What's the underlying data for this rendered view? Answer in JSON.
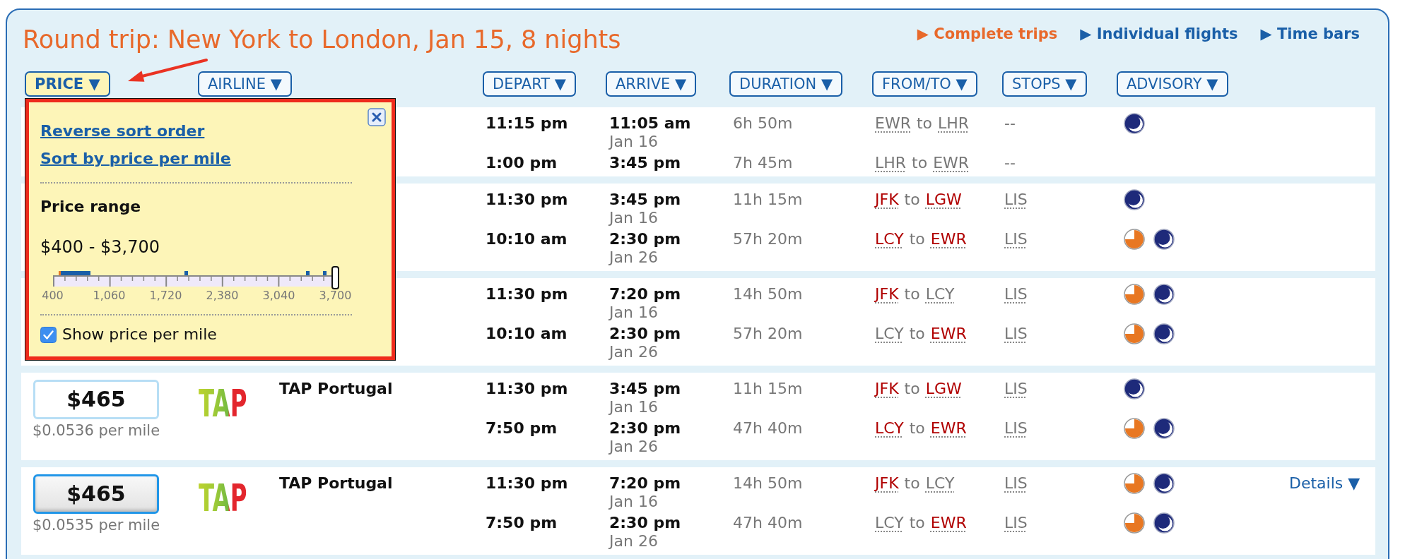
{
  "title": "Round trip: New York to London, Jan 15, 8 nights",
  "view_tabs": [
    {
      "label": "▶ Complete trips",
      "selected": true
    },
    {
      "label": "▶ Individual flights",
      "selected": false
    },
    {
      "label": "▶ Time bars",
      "selected": false
    }
  ],
  "sort_buttons": [
    {
      "label": "PRICE ▼",
      "selected": true
    },
    {
      "label": "AIRLINE ▼",
      "selected": false
    },
    {
      "label": "DEPART ▼",
      "selected": false
    },
    {
      "label": "ARRIVE ▼",
      "selected": false
    },
    {
      "label": "DURATION ▼",
      "selected": false
    },
    {
      "label": "FROM/TO ▼",
      "selected": false
    },
    {
      "label": "STOPS ▼",
      "selected": false
    },
    {
      "label": "ADVISORY ▼",
      "selected": false
    }
  ],
  "trips": [
    {
      "legs": [
        {
          "depart": "11:15 pm",
          "arrive": "11:05 am",
          "arrive_date": "Jan 16",
          "duration": "6h 50m",
          "origin": {
            "code": "EWR",
            "flagged": false
          },
          "joiner": "to",
          "destination": {
            "code": "LHR",
            "flagged": false
          },
          "stops": {
            "kind": "none",
            "text": "--"
          },
          "advisories": [
            {
              "kind": "moon"
            }
          ]
        },
        {
          "depart": "1:00 pm",
          "arrive": "3:45 pm",
          "duration": "7h 45m",
          "origin": {
            "code": "LHR",
            "flagged": false
          },
          "joiner": "to",
          "destination": {
            "code": "EWR",
            "flagged": false
          },
          "stops": {
            "kind": "none",
            "text": "--"
          }
        }
      ]
    },
    {
      "legs": [
        {
          "depart": "11:30 pm",
          "arrive": "3:45 pm",
          "arrive_date": "Jan 16",
          "duration": "11h 15m",
          "origin": {
            "code": "JFK",
            "flagged": true
          },
          "joiner": "to",
          "destination": {
            "code": "LGW",
            "flagged": true
          },
          "stops": {
            "kind": "airport",
            "text": "LIS"
          },
          "advisories": [
            {
              "kind": "moon"
            }
          ]
        },
        {
          "depart": "10:10 am",
          "arrive": "2:30 pm",
          "arrive_date": "Jan 26",
          "duration": "57h 20m",
          "origin": {
            "code": "LCY",
            "flagged": true
          },
          "joiner": "to",
          "destination": {
            "code": "EWR",
            "flagged": true
          },
          "stops": {
            "kind": "airport",
            "text": "LIS"
          },
          "advisories": [
            {
              "kind": "pie"
            },
            {
              "kind": "moon"
            }
          ]
        }
      ]
    },
    {
      "legs": [
        {
          "depart": "11:30 pm",
          "arrive": "7:20 pm",
          "arrive_date": "Jan 16",
          "duration": "14h 50m",
          "origin": {
            "code": "JFK",
            "flagged": true
          },
          "joiner": "to",
          "destination": {
            "code": "LCY",
            "flagged": false
          },
          "stops": {
            "kind": "airport",
            "text": "LIS"
          },
          "advisories": [
            {
              "kind": "pie"
            },
            {
              "kind": "moon"
            }
          ]
        },
        {
          "depart": "10:10 am",
          "arrive": "2:30 pm",
          "arrive_date": "Jan 26",
          "duration": "57h 20m",
          "origin": {
            "code": "LCY",
            "flagged": false
          },
          "joiner": "to",
          "destination": {
            "code": "EWR",
            "flagged": true
          },
          "stops": {
            "kind": "airport",
            "text": "LIS"
          },
          "advisories": [
            {
              "kind": "pie"
            },
            {
              "kind": "moon"
            }
          ]
        }
      ]
    },
    {
      "price": {
        "amount": "$465",
        "selected": false
      },
      "per_mile": "$0.0536 per mile",
      "airline": {
        "logo": "TAP",
        "name": "TAP Portugal"
      },
      "legs": [
        {
          "depart": "11:30 pm",
          "arrive": "3:45 pm",
          "arrive_date": "Jan 16",
          "duration": "11h 15m",
          "origin": {
            "code": "JFK",
            "flagged": true
          },
          "joiner": "to",
          "destination": {
            "code": "LGW",
            "flagged": true
          },
          "stops": {
            "kind": "airport",
            "text": "LIS"
          },
          "advisories": [
            {
              "kind": "moon"
            }
          ]
        },
        {
          "depart": "7:50 pm",
          "arrive": "2:30 pm",
          "arrive_date": "Jan 26",
          "duration": "47h 40m",
          "origin": {
            "code": "LCY",
            "flagged": true
          },
          "joiner": "to",
          "destination": {
            "code": "EWR",
            "flagged": true
          },
          "stops": {
            "kind": "airport",
            "text": "LIS"
          },
          "advisories": [
            {
              "kind": "pie"
            },
            {
              "kind": "moon"
            }
          ]
        }
      ]
    },
    {
      "price": {
        "amount": "$465",
        "selected": true
      },
      "per_mile": "$0.0535 per mile",
      "airline": {
        "logo": "TAP",
        "name": "TAP Portugal"
      },
      "details": "Details ▼",
      "legs": [
        {
          "depart": "11:30 pm",
          "arrive": "7:20 pm",
          "arrive_date": "Jan 16",
          "duration": "14h 50m",
          "origin": {
            "code": "JFK",
            "flagged": true
          },
          "joiner": "to",
          "destination": {
            "code": "LCY",
            "flagged": false
          },
          "stops": {
            "kind": "airport",
            "text": "LIS"
          },
          "advisories": [
            {
              "kind": "pie"
            },
            {
              "kind": "moon"
            }
          ]
        },
        {
          "depart": "7:50 pm",
          "arrive": "2:30 pm",
          "arrive_date": "Jan 26",
          "duration": "47h 40m",
          "origin": {
            "code": "LCY",
            "flagged": false
          },
          "joiner": "to",
          "destination": {
            "code": "EWR",
            "flagged": true
          },
          "stops": {
            "kind": "airport",
            "text": "LIS"
          },
          "advisories": [
            {
              "kind": "pie"
            },
            {
              "kind": "moon"
            }
          ]
        }
      ]
    }
  ],
  "popup": {
    "links": [
      "Reverse sort order",
      "Sort by price per mile"
    ],
    "section_title": "Price range",
    "range_text": "$400 - $3,700",
    "price_slider": {
      "level": 1,
      "ticks": [
        "400",
        "1,060",
        "1,720",
        "2,380",
        "3,040",
        "3,700"
      ]
    },
    "show_price_per_mile": {
      "label": "Show price per mile",
      "checked": true
    }
  }
}
